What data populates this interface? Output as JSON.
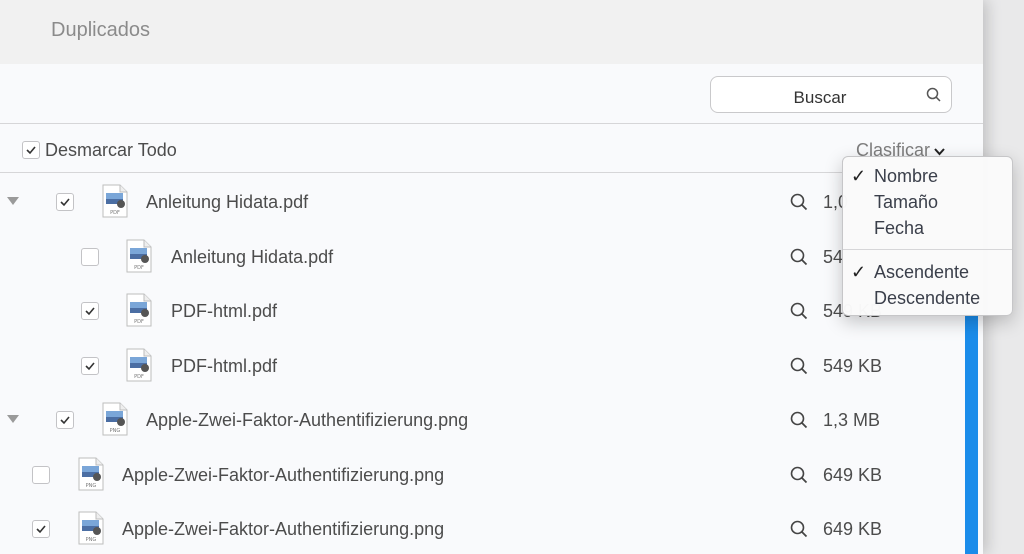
{
  "window": {
    "title": "Duplicados"
  },
  "search": {
    "placeholder": "Buscar"
  },
  "toolbar": {
    "unmark_all": "Desmarcar Todo",
    "sort_label": "Clasificar"
  },
  "sort_menu": {
    "items": [
      {
        "label": "Nombre",
        "checked": true
      },
      {
        "label": "Tamaño",
        "checked": false
      },
      {
        "label": "Fecha",
        "checked": false
      }
    ],
    "order_items": [
      {
        "label": "Ascendente",
        "checked": true
      },
      {
        "label": "Descendente",
        "checked": false
      }
    ]
  },
  "rows": [
    {
      "name": "Anleitung Hidata.pdf",
      "size": "1,0",
      "type": "PDF",
      "checked": true,
      "group": true
    },
    {
      "name": "Anleitung Hidata.pdf",
      "size": "54",
      "type": "PDF",
      "checked": false,
      "group": false
    },
    {
      "name": "PDF-html.pdf",
      "size": "549 KB",
      "type": "PDF",
      "checked": true,
      "group": false
    },
    {
      "name": "PDF-html.pdf",
      "size": "549 KB",
      "type": "PDF",
      "checked": true,
      "group": false
    },
    {
      "name": "Apple-Zwei-Faktor-Authentifizierung.png",
      "size": "1,3 MB",
      "type": "PNG",
      "checked": true,
      "group": true
    },
    {
      "name": "Apple-Zwei-Faktor-Authentifizierung.png",
      "size": "649 KB",
      "type": "PNG",
      "checked": false,
      "group": false
    },
    {
      "name": "Apple-Zwei-Faktor-Authentifizierung.png",
      "size": "649 KB",
      "type": "PNG",
      "checked": true,
      "group": false
    }
  ],
  "colors": {
    "accent": "#1a8cea",
    "menu_text": "#3a3f4a"
  }
}
